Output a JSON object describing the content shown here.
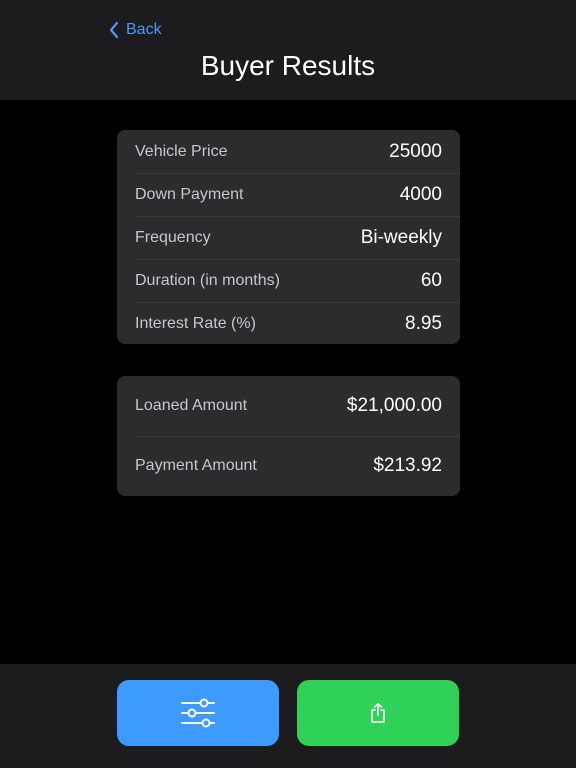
{
  "navbar": {
    "back_label": "Back",
    "title": "Buyer Results",
    "accent_color": "#4a9bf5"
  },
  "inputs": [
    {
      "label": "Vehicle Price",
      "value": "25000"
    },
    {
      "label": "Down Payment",
      "value": "4000"
    },
    {
      "label": "Frequency",
      "value": "Bi-weekly"
    },
    {
      "label": "Duration (in months)",
      "value": "60"
    },
    {
      "label": "Interest Rate (%)",
      "value": "8.95"
    }
  ],
  "results": [
    {
      "label": "Loaned Amount",
      "value": "$21,000.00"
    },
    {
      "label": "Payment Amount",
      "value": "$213.92"
    }
  ],
  "toolbar": {
    "settings_icon": "sliders-icon",
    "settings_color": "#3d9bff",
    "share_icon": "share-icon",
    "share_color": "#30d158"
  }
}
